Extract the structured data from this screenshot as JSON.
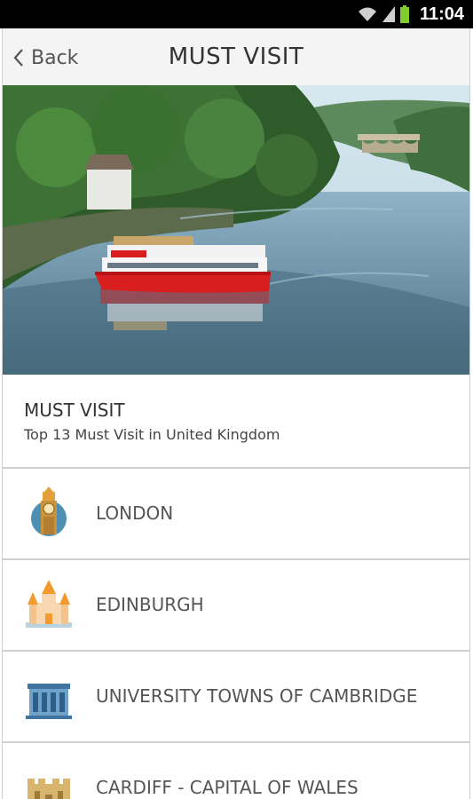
{
  "status_bar": {
    "time": "11:04",
    "icons": [
      "wifi-icon",
      "signal-icon",
      "battery-icon"
    ]
  },
  "app_bar": {
    "back_label": "Back",
    "title": "MUST VISIT"
  },
  "hero": {
    "image": "river-cruise-boat-photo"
  },
  "section": {
    "title": "MUST VISIT",
    "subtitle": "Top 13 Must Visit in United Kingdom"
  },
  "list": {
    "items": [
      {
        "label": "LONDON",
        "icon": "big-ben-icon"
      },
      {
        "label": "EDINBURGH",
        "icon": "castle-icon"
      },
      {
        "label": "UNIVERSITY TOWNS OF CAMBRIDGE",
        "icon": "university-building-icon"
      },
      {
        "label": "CARDIFF - CAPITAL OF WALES",
        "icon": "fortress-icon"
      }
    ]
  },
  "colors": {
    "status_bar": "#000000",
    "app_bar": "#f4f4f4",
    "divider": "#cfcfcf",
    "boat_red": "#d81e1e"
  }
}
